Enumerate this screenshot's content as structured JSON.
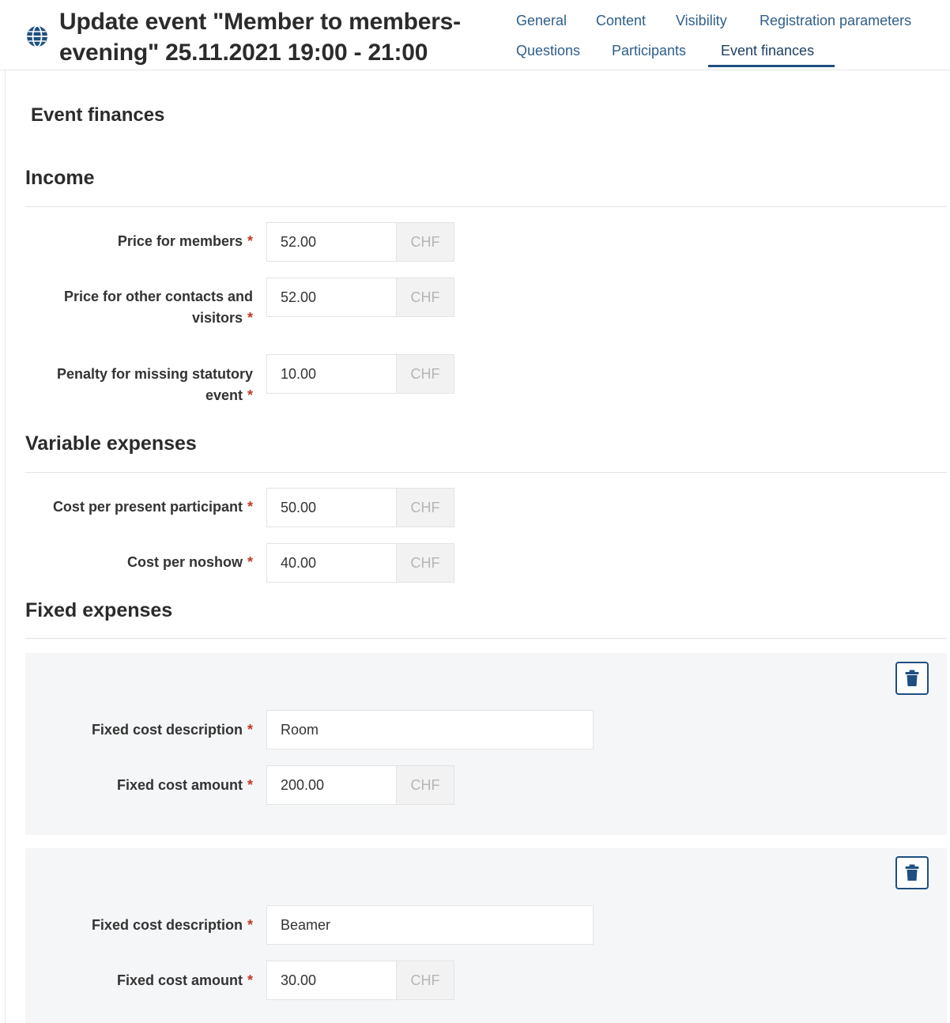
{
  "header": {
    "title": "Update event \"Member to members-evening\" 25.11.2021 19:00 - 21:00",
    "tabs": [
      {
        "label": "General",
        "active": false
      },
      {
        "label": "Content",
        "active": false
      },
      {
        "label": "Visibility",
        "active": false
      },
      {
        "label": "Registration parameters",
        "active": false
      },
      {
        "label": "Questions",
        "active": false
      },
      {
        "label": "Participants",
        "active": false
      },
      {
        "label": "Event finances",
        "active": true
      }
    ],
    "icon": "globe-icon"
  },
  "page_heading": "Event finances",
  "required_marker": "*",
  "currency": "CHF",
  "income": {
    "title": "Income",
    "fields": [
      {
        "label": "Price for members",
        "value": "52.00"
      },
      {
        "label": "Price for other contacts and visitors",
        "value": "52.00"
      },
      {
        "label": "Penalty for missing statutory event",
        "value": "10.00"
      }
    ]
  },
  "variable_expenses": {
    "title": "Variable expenses",
    "fields": [
      {
        "label": "Cost per present participant",
        "value": "50.00"
      },
      {
        "label": "Cost per noshow",
        "value": "40.00"
      }
    ]
  },
  "fixed_expenses": {
    "title": "Fixed expenses",
    "description_label": "Fixed cost description",
    "amount_label": "Fixed cost amount",
    "items": [
      {
        "description": "Room",
        "amount": "200.00"
      },
      {
        "description": "Beamer",
        "amount": "30.00"
      }
    ]
  },
  "colors": {
    "accent": "#1f4f80",
    "tab_text": "#2f5e8a",
    "required": "#c0392b",
    "card_background": "#f5f6f8"
  }
}
